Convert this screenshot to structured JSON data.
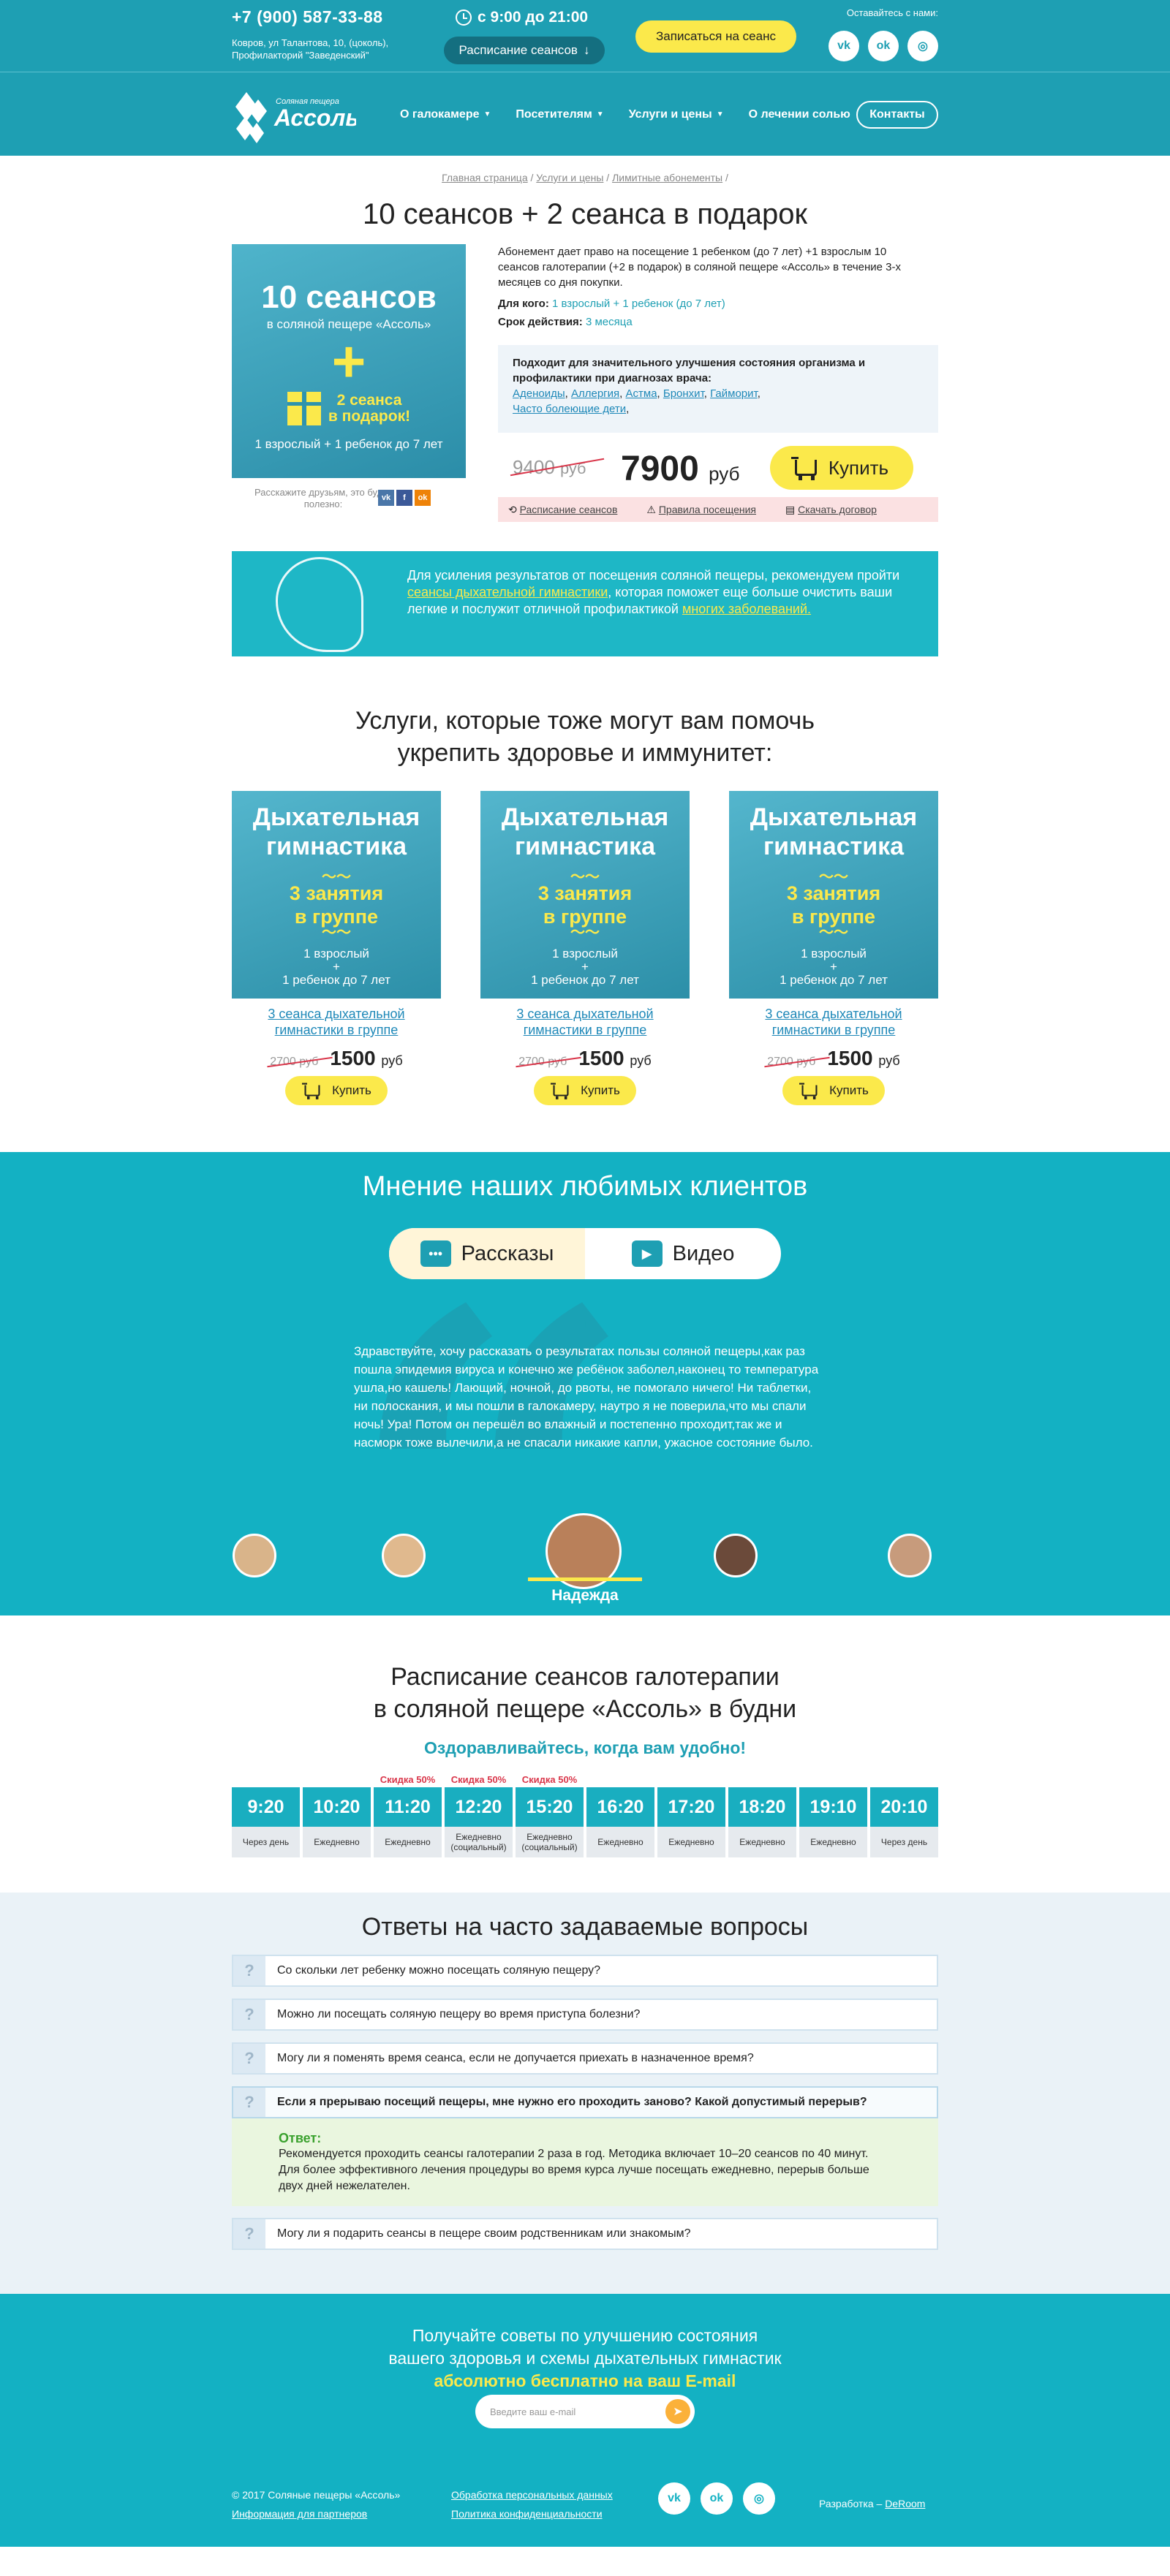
{
  "header": {
    "phone": "+7 (900) 587-33-88",
    "address_line1": "Ковров, ул Талантова, 10, (цоколь),",
    "address_line2": "Профилакторий \"Заведенский\"",
    "hours": "с 9:00 до 21:00",
    "schedule_button": "Расписание сеансов",
    "signup_button": "Записаться на сеанс",
    "stay_in_touch": "Оставайтесь с нами:",
    "socials": [
      "vk",
      "ok",
      "ig"
    ]
  },
  "logo": {
    "small": "Соляная пещера",
    "big": "Ассоль"
  },
  "nav": {
    "items": [
      "О галокамере",
      "Посетителям",
      "Услуги и цены",
      "О лечении солью"
    ],
    "contacts": "Контакты"
  },
  "breadcrumbs": [
    "Главная страница",
    "Услуги и цены",
    "Лимитные абонементы"
  ],
  "product": {
    "title": "10 сеансов + 2 сеанса в подарок",
    "banner": {
      "big": "10 сеансов",
      "sub": "в соляной пещере «Ассоль»",
      "plus": "+",
      "gift1": "2 сеанса",
      "gift2": "в подарок!",
      "foot": "1 взрослый + 1 ребенок до 7 лет"
    },
    "share": "Расскажите друзьям, это будет полезно:",
    "description": "Абонемент дает право на посещение 1 ребенком (до 7 лет) +1 взрослым 10 сеансов галотерапии (+2 в подарок) в соляной пещере «Ассоль» в течение 3-х месяцев со дня покупки.",
    "for_label": "Для кого:",
    "for_value": "1 взрослый + 1 ребенок (до 7 лет)",
    "term_label": "Срок действия:",
    "term_value": "3 месяца",
    "suits_heading": "Подходит для значительного улучшения состояния организма и профилактики при диагнозах врача:",
    "diagnoses": [
      "Аденоиды",
      "Аллергия",
      "Астма",
      "Бронхит",
      "Гайморит",
      "Часто болеющие дети"
    ],
    "old_price": "9400",
    "old_unit": "руб",
    "price": "7900",
    "unit": "руб",
    "buy": "Купить",
    "links": [
      "Расписание сеансов",
      "Правила посещения",
      "Скачать договор"
    ]
  },
  "tip": {
    "text1": "Для усиления результатов от посещения соляной пещеры, рекомендуем пройти ",
    "link1": "сеансы дыхательной гимнастики",
    "text2": ", которая поможет еще больше очистить ваши легкие и послужит отличной профилактикой ",
    "link2": "многих заболеваний."
  },
  "services": {
    "heading1": "Услуги, которые тоже могут вам помочь",
    "heading2": "укрепить здоровье и иммунитет:",
    "cards": [
      {
        "t1": "Дыхательная",
        "t2": "гимнастика",
        "y1": "3 занятия",
        "y2": "в группе",
        "w1": "1 взрослый",
        "w2": "+",
        "w3": "1 ребенок до 7 лет",
        "link": "3 сеанса дыхательной гимнастики в группе",
        "old": "2700 руб",
        "price": "1500",
        "unit": "руб",
        "buy": "Купить"
      },
      {
        "t1": "Дыхательная",
        "t2": "гимнастика",
        "y1": "3 занятия",
        "y2": "в группе",
        "w1": "1 взрослый",
        "w2": "+",
        "w3": "1 ребенок до 7 лет",
        "link": "3 сеанса дыхательной гимнастики в группе",
        "old": "2700 руб",
        "price": "1500",
        "unit": "руб",
        "buy": "Купить"
      },
      {
        "t1": "Дыхательная",
        "t2": "гимнастика",
        "y1": "3 занятия",
        "y2": "в группе",
        "w1": "1 взрослый",
        "w2": "+",
        "w3": "1 ребенок до 7 лет",
        "link": "3 сеанса дыхательной гимнастики в группе",
        "old": "2700 руб",
        "price": "1500",
        "unit": "руб",
        "buy": "Купить"
      }
    ]
  },
  "reviews": {
    "heading": "Мнение наших любимых клиентов",
    "tab_stories": "Рассказы",
    "tab_video": "Видео",
    "quote": "❝",
    "text": "Здравствуйте, хочу рассказать о результатах пользы соляной пещеры,как раз пошла эпидемия вируса и конечно же ребёнок заболел,наконец то температура ушла,но кашель! Лающий, ночной, до рвоты, не помогало ничего! Ни таблетки, ни полоскания, и мы пошли в галокамеру, наутро я не поверила,что мы спали ночь! Ура! Потом он перешёл во влажный и постепенно проходит,так же и насморк тоже вылечили,а не спасали никакие капли, ужасное состояние было.",
    "active_name": "Надежда"
  },
  "schedule": {
    "heading1": "Расписание сеансов галотерапии",
    "heading2": "в соляной пещере «Ассоль» в будни",
    "subheading": "Оздоравливайтесь, когда вам удобно!",
    "slots": [
      {
        "time": "9:20",
        "freq": "Через день",
        "disc": ""
      },
      {
        "time": "10:20",
        "freq": "Ежедневно",
        "disc": ""
      },
      {
        "time": "11:20",
        "freq": "Ежедневно",
        "disc": "Скидка 50%"
      },
      {
        "time": "12:20",
        "freq": "Ежедневно (социальный)",
        "disc": "Скидка 50%"
      },
      {
        "time": "15:20",
        "freq": "Ежедневно (социальный)",
        "disc": "Скидка 50%"
      },
      {
        "time": "16:20",
        "freq": "Ежедневно",
        "disc": ""
      },
      {
        "time": "17:20",
        "freq": "Ежедневно",
        "disc": ""
      },
      {
        "time": "18:20",
        "freq": "Ежедневно",
        "disc": ""
      },
      {
        "time": "19:10",
        "freq": "Ежедневно",
        "disc": ""
      },
      {
        "time": "20:10",
        "freq": "Через день",
        "disc": ""
      }
    ]
  },
  "faq": {
    "heading": "Ответы на часто задаваемые вопросы",
    "qmark": "?",
    "items": [
      "Со скольки лет ребенку можно посещать соляную пещеру?",
      "Можно ли посещать соляную пещеру во время приступа болезни?",
      "Могу ли я поменять время сеанса, если не допучается приехать в назначенное время?",
      "Если я прерываю посещий пещеры, мне нужно его проходить заново? Какой допустимый перерыв?",
      "Могу ли я подарить сеансы в пещере своим родственникам или знакомым?"
    ],
    "answer_label": "Ответ:",
    "answer": "Рекомендуется проходить сеансы галотерапии 2 раза в год. Методика включает 10–20 сеансов по 40 минут. Для более эффективного лечения процедуры во время курса лучше посещать ежедневно, перерыв больше двух дней нежелателен."
  },
  "footer": {
    "line1": "Получайте советы по улучшению состояния",
    "line2": "вашего здоровья и схемы дыхательных гимнастик",
    "line3": "абсолютно бесплатно на ваш E-mail",
    "email_placeholder": "Введите ваш e-mail",
    "copyright": "© 2017 Соляные пещеры «Ассоль»",
    "partners": "Информация для партнеров",
    "personal": "Обработка персональных данных",
    "privacy": "Политика конфиденциальности",
    "dev_label": "Разработка –",
    "dev": "DeRoom"
  },
  "colors": {
    "brand": "#1e9fb3",
    "accent": "#fbe94b",
    "sale": "#d9364a"
  }
}
